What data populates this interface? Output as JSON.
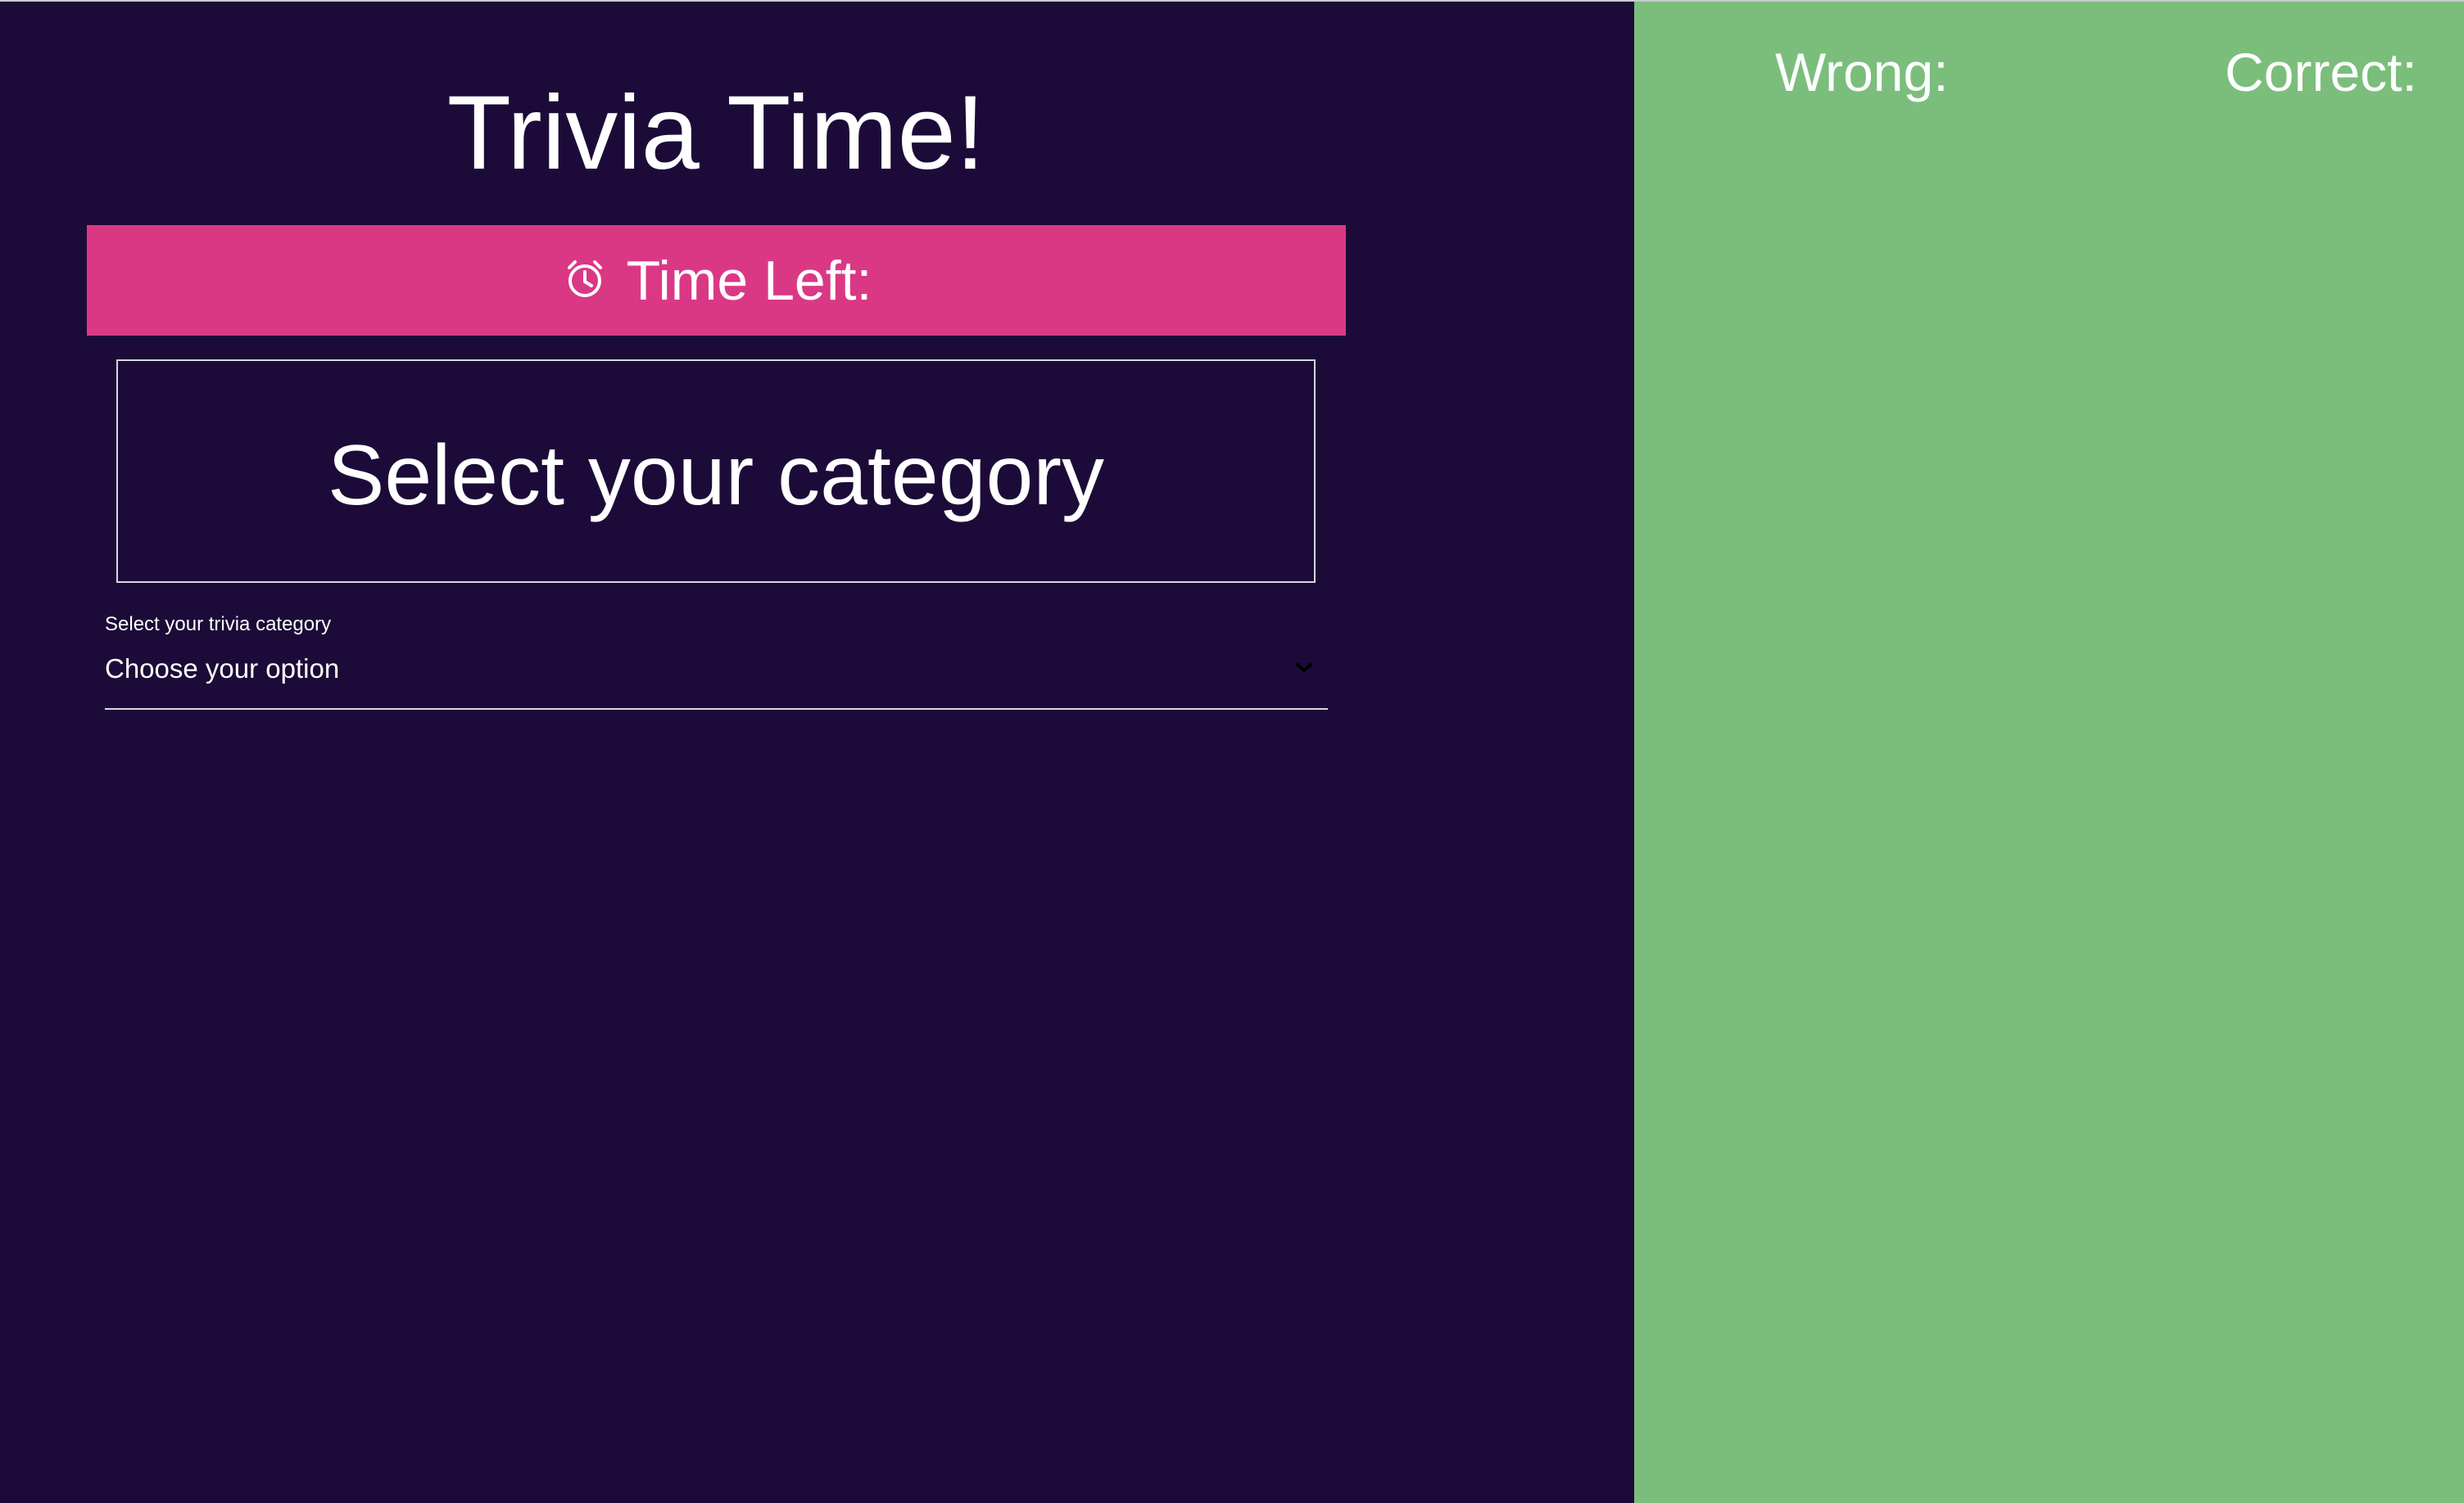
{
  "app": {
    "title": "Trivia Time!"
  },
  "timer": {
    "icon": "alarm-clock-icon",
    "label": "Time Left:"
  },
  "question": {
    "text": "Select your category"
  },
  "category_select": {
    "label": "Select your trivia category",
    "selected_value": "Choose your option",
    "icon": "chevron-down-icon"
  },
  "score_panel": {
    "wrong_label": "Wrong:",
    "correct_label": "Correct:"
  },
  "colors": {
    "main_background": "#1c0b38",
    "timer_bar": "#da3885",
    "score_panel_background": "#7bbe7c",
    "text": "#ffffff"
  }
}
